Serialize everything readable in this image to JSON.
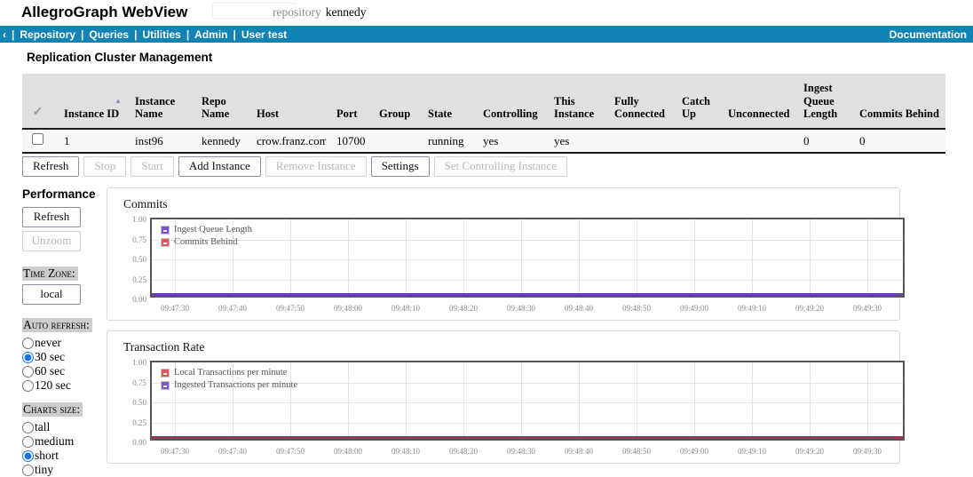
{
  "colors": {
    "nav_bar": "#1183b4",
    "series_purple": "#7b52cf",
    "series_red": "#dd5760",
    "radio_accent": "#1a73e8"
  },
  "header": {
    "title": "AllegroGraph WebView",
    "repo_label": "repository",
    "repo_name": "kennedy"
  },
  "nav": {
    "back": "‹",
    "items": [
      "Repository",
      "Queries",
      "Utilities",
      "Admin",
      "User test"
    ],
    "doc_link": "Documentation"
  },
  "cluster": {
    "heading": "Replication Cluster Management",
    "table": {
      "select_all_icon": "✓",
      "sort_arrow": "▲",
      "sorted_column": "Instance ID",
      "columns": [
        "Instance ID",
        "Instance Name",
        "Repo Name",
        "Host",
        "Port",
        "Group",
        "State",
        "Controlling",
        "This Instance",
        "Fully Connected",
        "Catch Up",
        "Unconnected",
        "Ingest Queue Length",
        "Commits Behind"
      ],
      "rows": [
        {
          "checked": false,
          "cells": [
            "1",
            "inst96",
            "kennedy",
            "crow.franz.com",
            "10700",
            "",
            "running",
            "yes",
            "yes",
            "",
            "",
            "",
            "0",
            "0"
          ]
        }
      ]
    },
    "actions": [
      {
        "label": "Refresh",
        "enabled": true
      },
      {
        "label": "Stop",
        "enabled": false
      },
      {
        "label": "Start",
        "enabled": false
      },
      {
        "label": "Add Instance",
        "enabled": true
      },
      {
        "label": "Remove Instance",
        "enabled": false
      },
      {
        "label": "Settings",
        "enabled": true
      },
      {
        "label": "Set Controlling Instance",
        "enabled": false
      }
    ]
  },
  "performance": {
    "heading": "Performance",
    "buttons": [
      {
        "label": "Refresh",
        "enabled": true
      },
      {
        "label": "Unzoom",
        "enabled": false
      }
    ],
    "timezone": {
      "label": "Time Zone:",
      "button": "local"
    },
    "radio_groups": [
      {
        "name": "auto-refresh",
        "label": "Auto refresh:",
        "options": [
          "never",
          "30 sec",
          "60 sec",
          "120 sec"
        ],
        "selected": 1
      },
      {
        "name": "charts-size",
        "label": "Charts size:",
        "options": [
          "tall",
          "medium",
          "short",
          "tiny"
        ],
        "selected": 2
      }
    ]
  },
  "chart_data": [
    {
      "type": "line",
      "title": "Commits",
      "ylim": [
        0,
        1
      ],
      "grid": true,
      "legend_position": "top-left",
      "y_ticks": [
        "1.00",
        "0.75",
        "0.50",
        "0.25",
        "0.00"
      ],
      "x_ticks": [
        "09:47:30",
        "09:47:40",
        "09:47:50",
        "09:48:00",
        "09:48:10",
        "09:48:20",
        "09:48:30",
        "09:48:40",
        "09:48:50",
        "09:49:00",
        "09:49:10",
        "09:49:20",
        "09:49:30"
      ],
      "series": [
        {
          "name": "Ingest Queue Length",
          "color": "#7b52cf",
          "values": [
            0,
            0,
            0,
            0,
            0,
            0,
            0,
            0,
            0,
            0,
            0,
            0,
            0
          ]
        },
        {
          "name": "Commits Behind",
          "color": "#dd5760",
          "values": [
            0,
            0,
            0,
            0,
            0,
            0,
            0,
            0,
            0,
            0,
            0,
            0,
            0
          ]
        }
      ],
      "plotted_line_color": "#6a3fa8"
    },
    {
      "type": "line",
      "title": "Transaction Rate",
      "ylim": [
        0,
        1
      ],
      "grid": true,
      "legend_position": "top-left",
      "y_ticks": [
        "1.00",
        "0.75",
        "0.50",
        "0.25",
        "0.00"
      ],
      "x_ticks": [
        "09:47:30",
        "09:47:40",
        "09:47:50",
        "09:48:00",
        "09:48:10",
        "09:48:20",
        "09:48:30",
        "09:48:40",
        "09:48:50",
        "09:49:00",
        "09:49:10",
        "09:49:20",
        "09:49:30"
      ],
      "series": [
        {
          "name": "Local Transactions per minute",
          "color": "#dd5760",
          "values": [
            0,
            0,
            0,
            0,
            0,
            0,
            0,
            0,
            0,
            0,
            0,
            0,
            0
          ]
        },
        {
          "name": "Ingested Transactions per minute",
          "color": "#7b52cf",
          "values": [
            0,
            0,
            0,
            0,
            0,
            0,
            0,
            0,
            0,
            0,
            0,
            0,
            0
          ]
        }
      ],
      "plotted_line_color": "#a93055"
    }
  ]
}
